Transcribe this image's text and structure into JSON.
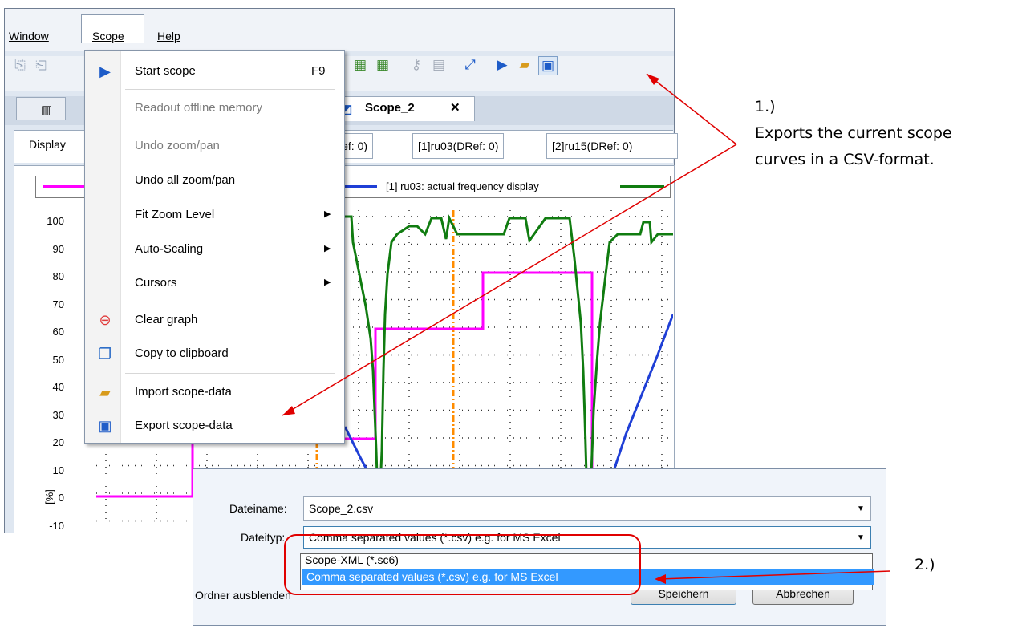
{
  "menubar": {
    "window": "Window",
    "scope": "Scope",
    "help": "Help"
  },
  "tabs": {
    "active": "Scope_2"
  },
  "display_tab": "Display",
  "channels": [
    "Ref: 0)",
    "[1]ru03(DRef: 0)",
    "[2]ru15(DRef: 0)"
  ],
  "legend": {
    "series1": "[1] ru03: actual frequency display"
  },
  "y_axis": {
    "unit": "[%]",
    "ticks": [
      "100",
      "90",
      "80",
      "70",
      "60",
      "50",
      "40",
      "30",
      "20",
      "10",
      "0",
      "-10"
    ]
  },
  "menu": {
    "items": [
      {
        "label": "Start scope",
        "shortcut": "F9",
        "icon": "start-scope-icon"
      },
      {
        "label": "Readout offline memory",
        "disabled": true
      },
      {
        "label": "Undo zoom/pan",
        "disabled": true
      },
      {
        "label": "Undo all zoom/pan"
      },
      {
        "label": "Fit Zoom Level",
        "submenu": true
      },
      {
        "label": "Auto-Scaling",
        "submenu": true
      },
      {
        "label": "Cursors",
        "submenu": true
      },
      {
        "label": "Clear graph",
        "icon": "clear-graph-icon"
      },
      {
        "label": "Copy to clipboard",
        "icon": "copy-icon"
      },
      {
        "label": "Import scope-data",
        "icon": "import-icon"
      },
      {
        "label": "Export scope-data",
        "icon": "export-icon"
      }
    ]
  },
  "dialog": {
    "filename_label": "Dateiname:",
    "filename_value": "Scope_2.csv",
    "filetype_label": "Dateityp:",
    "filetype_value": "Comma separated values (*.csv) e.g. for MS Excel",
    "options": [
      "Scope-XML (*.sc6)",
      "Comma separated values (*.csv) e.g. for MS Excel"
    ],
    "hide_folders": "Ordner ausblenden",
    "save_button": "Speichern",
    "cancel_button": "Abbrechen"
  },
  "annotations": {
    "step1_number": "1.)",
    "step1_text_line1": "Exports the current scope",
    "step1_text_line2": "curves in a CSV-format.",
    "step2_number": "2.)"
  },
  "colors": {
    "magenta": "#ff00ff",
    "green": "#107c10",
    "blue": "#1f3fd6",
    "orange": "#ff8c00",
    "arrow": "#e00000",
    "highlight": "#3399ff"
  }
}
